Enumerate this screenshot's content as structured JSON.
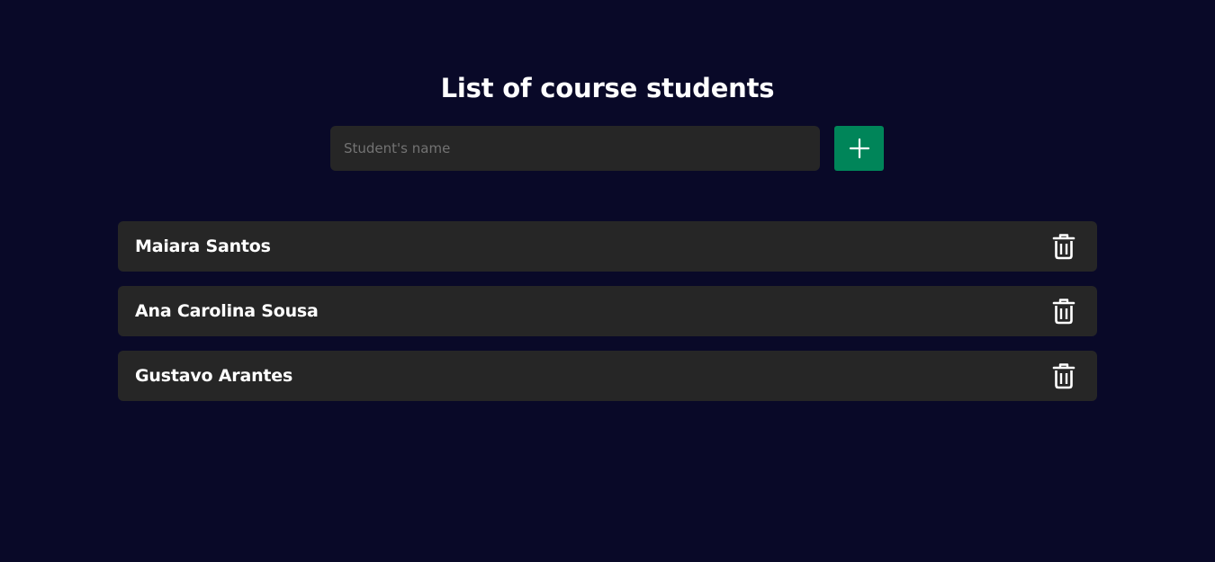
{
  "page": {
    "title": "List of course students"
  },
  "form": {
    "input_placeholder": "Student's name",
    "input_value": "",
    "add_button_icon": "plus-icon"
  },
  "students": [
    {
      "name": "Maiara Santos",
      "delete_icon": "trash-icon"
    },
    {
      "name": "Ana Carolina Sousa",
      "delete_icon": "trash-icon"
    },
    {
      "name": "Gustavo Arantes",
      "delete_icon": "trash-icon"
    }
  ],
  "colors": {
    "background": "#090928",
    "surface": "#262626",
    "accent": "#008559",
    "text": "#ffffff",
    "placeholder": "#737373"
  }
}
